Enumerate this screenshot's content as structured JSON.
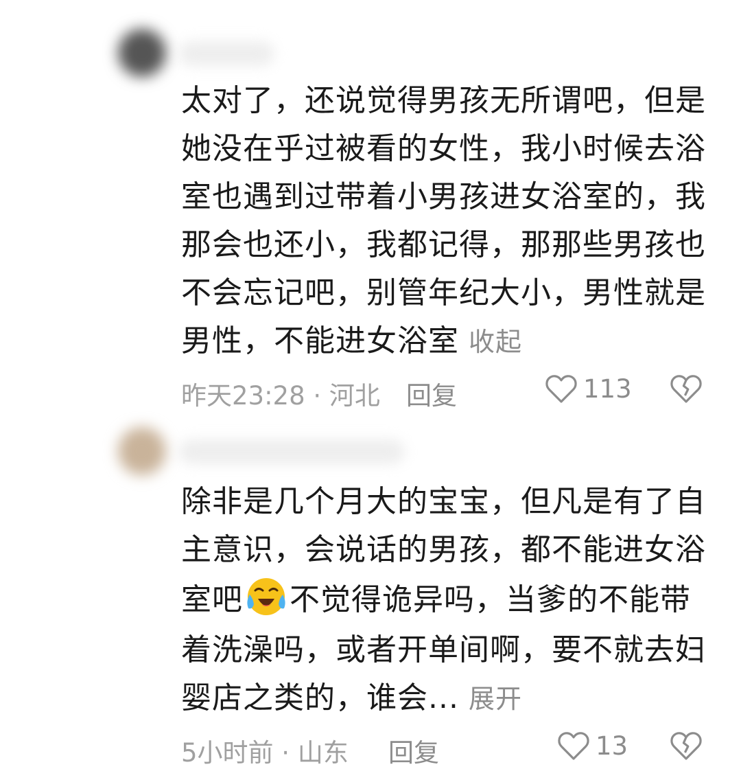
{
  "comments": [
    {
      "lines": [
        "太对了，还说觉得男孩无所谓吧，但是",
        "她没在乎过被看的女性，我小时候去浴",
        "室也遇到过带着小男孩进女浴室的，我",
        "那会也还小，我都记得，那那些男孩也",
        "不会忘记吧，别管年纪大小，男性就是"
      ],
      "last_line": "男性，不能进女浴室",
      "toggle_label": "收起",
      "time_location": "昨天23:28 · 河北",
      "reply_label": "回复",
      "like_count": "113",
      "like_icon": "heart-outline-icon",
      "dislike_icon": "broken-heart-icon"
    },
    {
      "lines": [
        "除非是几个月大的宝宝，但凡是有了自",
        "主意识，会说话的男孩，都不能进女浴"
      ],
      "line3_before_emoji": "室吧",
      "emoji": "crying-laughing-emoji",
      "line3_after_emoji": "不觉得诡异吗，当爹的不能带",
      "line4": "着洗澡吗，或者开单间啊，要不就去妇",
      "last_line": "婴店之类的，谁会...",
      "toggle_label": "展开",
      "time_location": "5小时前 · 山东",
      "reply_label": "回复",
      "like_count": "13",
      "like_icon": "heart-outline-icon",
      "dislike_icon": "broken-heart-icon"
    }
  ],
  "colors": {
    "text": "#1a1a1a",
    "meta": "#a0a0a0",
    "action": "#8c8c8c",
    "emoji": "#f7c21a"
  }
}
